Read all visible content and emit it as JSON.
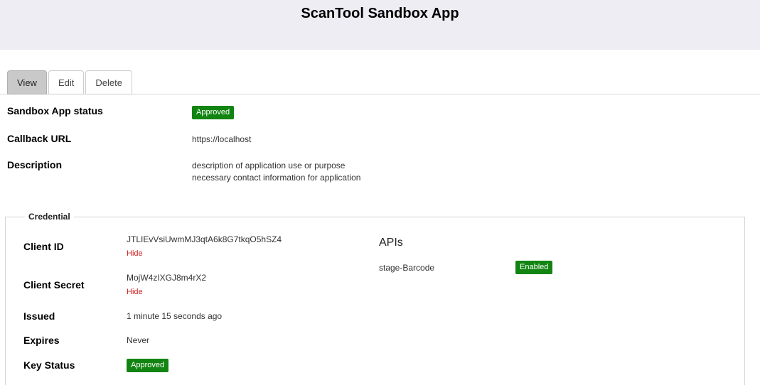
{
  "header": {
    "title": "ScanTool Sandbox App"
  },
  "tabs": {
    "view": "View",
    "edit": "Edit",
    "delete": "Delete"
  },
  "details": {
    "status_label": "Sandbox App status",
    "status_value": "Approved",
    "callback_label": "Callback URL",
    "callback_value": "https://localhost",
    "description_label": "Description",
    "description_line1": "description of application use or purpose",
    "description_line2": "necessary contact information for application"
  },
  "credential": {
    "legend": "Credential",
    "client_id_label": "Client ID",
    "client_id_value": "JTLIEvVsiUwmMJ3qtA6k8G7tkqO5hSZ4",
    "client_id_toggle": "Hide",
    "client_secret_label": "Client Secret",
    "client_secret_value": "MojW4zIXGJ8m4rX2",
    "client_secret_toggle": "Hide",
    "issued_label": "Issued",
    "issued_value": "1 minute 15 seconds ago",
    "expires_label": "Expires",
    "expires_value": "Never",
    "key_status_label": "Key Status",
    "key_status_value": "Approved"
  },
  "apis": {
    "heading": "APIs",
    "items": [
      {
        "name": "stage-Barcode",
        "status": "Enabled"
      }
    ]
  },
  "colors": {
    "status_green": "#128412",
    "link_red": "#cc2222",
    "header_bg": "#ededf3"
  }
}
